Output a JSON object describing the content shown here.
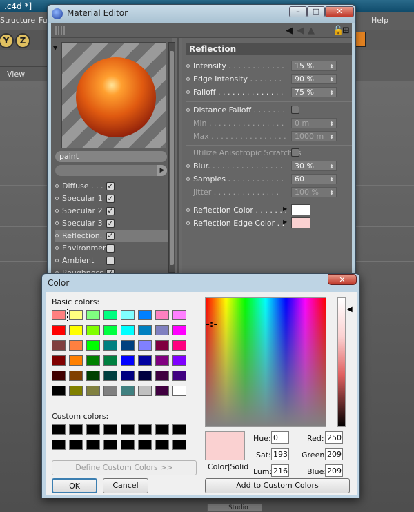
{
  "background_app": {
    "title": ".c4d *]",
    "menu": [
      "Structure",
      "Fu",
      "Help"
    ],
    "axis_buttons": [
      "Y",
      "Z"
    ],
    "view_label": "View",
    "studio_label": "Studio"
  },
  "material_editor": {
    "title": "Material Editor",
    "window_buttons": {
      "minimize": "–",
      "maximize": "□",
      "close": "✕"
    },
    "material_name": "paint",
    "channels": [
      {
        "label": "Diffuse . . . .",
        "checked": true
      },
      {
        "label": "Specular 1",
        "checked": true
      },
      {
        "label": "Specular 2",
        "checked": true
      },
      {
        "label": "Specular 3",
        "checked": true
      },
      {
        "label": "Reflection. .",
        "checked": true,
        "selected": true
      },
      {
        "label": "Environment",
        "checked": false
      },
      {
        "label": "Ambient",
        "checked": false
      },
      {
        "label": "Roughness",
        "checked": true
      }
    ],
    "section_title": "Reflection",
    "props": {
      "intensity": {
        "label": "Intensity . . . . . . . . . . . .",
        "value": "15 %"
      },
      "edge_intensity": {
        "label": "Edge Intensity . . . . . . .",
        "value": "90 %"
      },
      "falloff": {
        "label": "Falloff . . . . . . . . . . . . . .",
        "value": "75 %"
      },
      "distance_falloff": {
        "label": "Distance Falloff . . . . . . ."
      },
      "min": {
        "label": "Min . . . . . . . . . . . . . . . .",
        "value": "0 m"
      },
      "max": {
        "label": "Max . . . . . . . . . . . . . . . .",
        "value": "1000 m"
      },
      "aniso": {
        "label": "Utilize Anisotropic Scratches"
      },
      "blur": {
        "label": "Blur. . . . . . . . . . . . . . . .",
        "value": "30 %"
      },
      "samples": {
        "label": "Samples . . . . . . . . . . . .",
        "value": "60"
      },
      "jitter": {
        "label": "Jitter . . . . . . . . . . . . . .",
        "value": "100 %"
      },
      "reflection_color": {
        "label": "Reflection Color . . . . . . .",
        "color": "#ffffff"
      },
      "edge_color": {
        "label": "Reflection Edge Color . .",
        "color": "#fad1d1"
      }
    }
  },
  "color_dialog": {
    "title": "Color",
    "close": "✕",
    "basic_colors_label": "Basic colors:",
    "custom_colors_label": "Custom colors:",
    "define_custom": "Define Custom Colors >>",
    "ok": "OK",
    "cancel": "Cancel",
    "add_custom": "Add to Custom Colors",
    "color_solid": "Color|Solid",
    "hue_label": "Hue:",
    "hue": "0",
    "sat_label": "Sat:",
    "sat": "193",
    "lum_label": "Lum:",
    "lum": "216",
    "red_label": "Red:",
    "red": "250",
    "green_label": "Green:",
    "green": "209",
    "blue_label": "Blue:",
    "blue": "209",
    "current_color": "#fad1d1",
    "basic_colors": [
      "#ff8080",
      "#ffff80",
      "#80ff80",
      "#00ff80",
      "#80ffff",
      "#0080ff",
      "#ff80c0",
      "#ff80ff",
      "#ff0000",
      "#ffff00",
      "#80ff00",
      "#00ff40",
      "#00ffff",
      "#0080c0",
      "#8080c0",
      "#ff00ff",
      "#804040",
      "#ff8040",
      "#00ff00",
      "#008080",
      "#004080",
      "#8080ff",
      "#800040",
      "#ff0080",
      "#800000",
      "#ff8000",
      "#008000",
      "#008040",
      "#0000ff",
      "#0000a0",
      "#800080",
      "#8000ff",
      "#400000",
      "#804000",
      "#004000",
      "#004040",
      "#000080",
      "#000040",
      "#400040",
      "#400080",
      "#000000",
      "#808000",
      "#808040",
      "#808080",
      "#408080",
      "#c0c0c0",
      "#400040",
      "#ffffff"
    ]
  }
}
